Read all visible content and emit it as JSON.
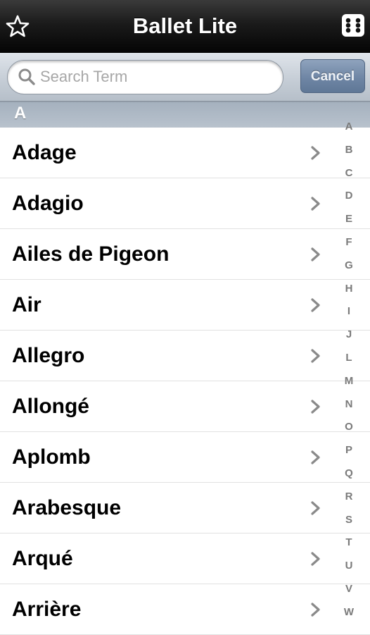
{
  "navbar": {
    "title": "Ballet Lite",
    "left_icon": "star-outline-icon",
    "right_icon": "grid-menu-icon"
  },
  "search": {
    "placeholder": "Search Term",
    "value": "",
    "cancel_label": "Cancel"
  },
  "section": {
    "header": "A"
  },
  "items": [
    {
      "label": "Adage"
    },
    {
      "label": "Adagio"
    },
    {
      "label": "Ailes de Pigeon"
    },
    {
      "label": "Air"
    },
    {
      "label": "Allegro"
    },
    {
      "label": "Allongé"
    },
    {
      "label": "Aplomb"
    },
    {
      "label": "Arabesque"
    },
    {
      "label": "Arqué"
    },
    {
      "label": "Arrière"
    }
  ],
  "index_letters": [
    "A",
    "B",
    "C",
    "D",
    "E",
    "F",
    "G",
    "H",
    "I",
    "J",
    "L",
    "M",
    "N",
    "O",
    "P",
    "Q",
    "R",
    "S",
    "T",
    "U",
    "V",
    "W"
  ],
  "colors": {
    "navbar_bg": "#1b1b1b",
    "cancel_button": "#6f86a5",
    "section_header": "#b0bbc7",
    "index_text": "#7a7a7a"
  }
}
